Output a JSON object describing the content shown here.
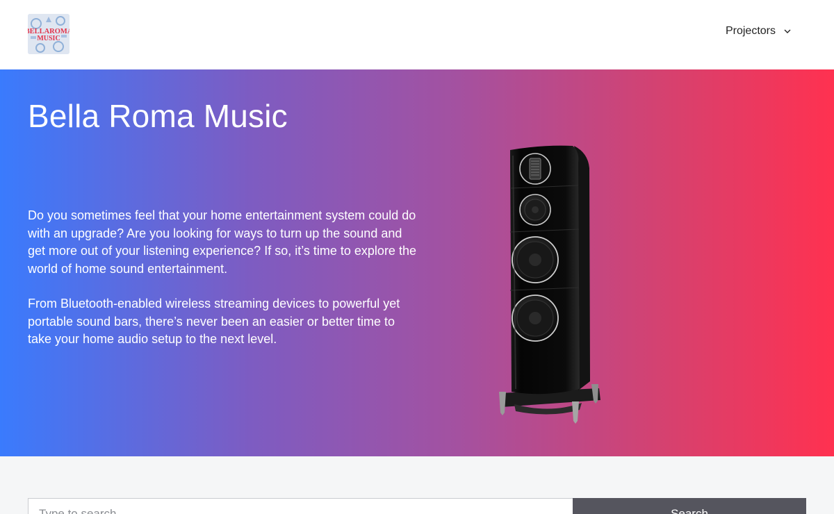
{
  "header": {
    "logo": {
      "alt": "BELLAROMA MUSIC",
      "line1": "BELLAROMA",
      "line2": "MUSIC",
      "icon": "logo-icon"
    },
    "nav": {
      "label": "Projectors",
      "icon": "chevron-down-icon"
    }
  },
  "hero": {
    "title": "Bella Roma Music",
    "paragraphs": [
      "Do you sometimes feel that your home entertainment system could do with an upgrade? Are you looking for ways to turn up the sound and get more out of your listening experience? If so, it’s time to explore the world of home sound entertainment.",
      "From Bluetooth-enabled wireless streaming devices to powerful yet portable sound bars, there’s never been an easier or better time to take your home audio setup to the next level."
    ],
    "image": {
      "icon": "speaker-image"
    }
  },
  "search": {
    "placeholder": "Type to search",
    "button_label": "Search"
  },
  "colors": {
    "gradient_start": "#3a7bfd",
    "gradient_end": "#ff3150",
    "button_bg": "#55555e"
  }
}
